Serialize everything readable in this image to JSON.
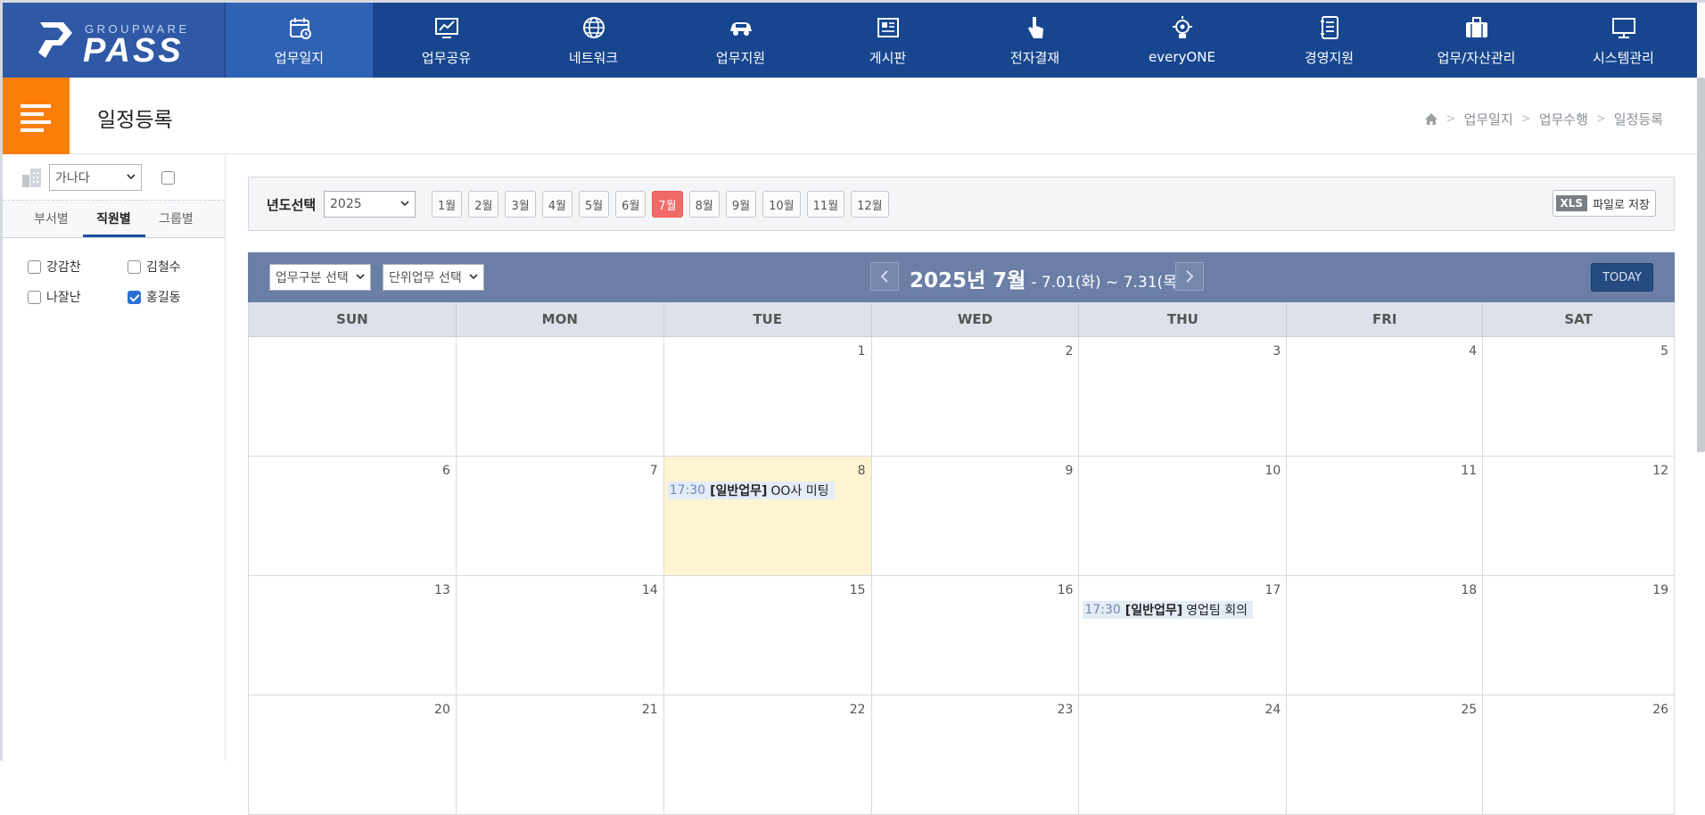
{
  "brand": {
    "top": "GROUPWARE",
    "name": "PASS"
  },
  "nav": [
    {
      "label": "업무일지",
      "icon": "calendar-icon",
      "active": true
    },
    {
      "label": "업무공유",
      "icon": "chart-board-icon",
      "active": false
    },
    {
      "label": "네트워크",
      "icon": "globe-icon",
      "active": false
    },
    {
      "label": "업무지원",
      "icon": "car-icon",
      "active": false
    },
    {
      "label": "게시판",
      "icon": "newspaper-icon",
      "active": false
    },
    {
      "label": "전자결재",
      "icon": "touch-hand-icon",
      "active": false
    },
    {
      "label": "everyONE",
      "icon": "lightbulb-gear-icon",
      "active": false
    },
    {
      "label": "경영지원",
      "icon": "notebook-icon",
      "active": false
    },
    {
      "label": "업무/자산관리",
      "icon": "briefcase-icon",
      "active": false
    },
    {
      "label": "시스템관리",
      "icon": "monitor-icon",
      "active": false
    }
  ],
  "page": {
    "title": "일정등록",
    "breadcrumb": [
      "업무일지",
      "업무수행",
      "일정등록"
    ]
  },
  "left": {
    "sort_select": "가나다",
    "tabs": [
      "부서별",
      "직원별",
      "그룹별"
    ],
    "active_tab": 1,
    "people": [
      {
        "name": "강감찬",
        "checked": false
      },
      {
        "name": "김철수",
        "checked": false
      },
      {
        "name": "나잘난",
        "checked": false
      },
      {
        "name": "홍길동",
        "checked": true
      }
    ]
  },
  "yearbar": {
    "label": "년도선택",
    "year": "2025",
    "months": [
      "1월",
      "2월",
      "3월",
      "4월",
      "5월",
      "6월",
      "7월",
      "8월",
      "9월",
      "10월",
      "11월",
      "12월"
    ],
    "active_month": 6,
    "xls_badge": "XLS",
    "xls_label": "파일로 저장"
  },
  "calendar": {
    "filter1": "업무구분 선택",
    "filter2": "단위업무 선택",
    "title": "2025년 7월",
    "range": "- 7.01(화) ~ 7.31(목)",
    "today_label": "TODAY",
    "days": [
      "SUN",
      "MON",
      "TUE",
      "WED",
      "THU",
      "FRI",
      "SAT"
    ],
    "weeks": [
      [
        "",
        "",
        "1",
        "2",
        "3",
        "4",
        "5"
      ],
      [
        "6",
        "7",
        "8",
        "9",
        "10",
        "11",
        "12"
      ],
      [
        "13",
        "14",
        "15",
        "16",
        "17",
        "18",
        "19"
      ],
      [
        "20",
        "21",
        "22",
        "23",
        "24",
        "25",
        "26"
      ]
    ],
    "today_cell": [
      1,
      2
    ],
    "events": [
      {
        "week": 1,
        "day": 2,
        "time": "17:30",
        "kind": "[일반업무]",
        "title": "OO사 미팅"
      },
      {
        "week": 2,
        "day": 4,
        "time": "17:30",
        "kind": "[일반업무]",
        "title": "영업팀 회의"
      }
    ]
  }
}
